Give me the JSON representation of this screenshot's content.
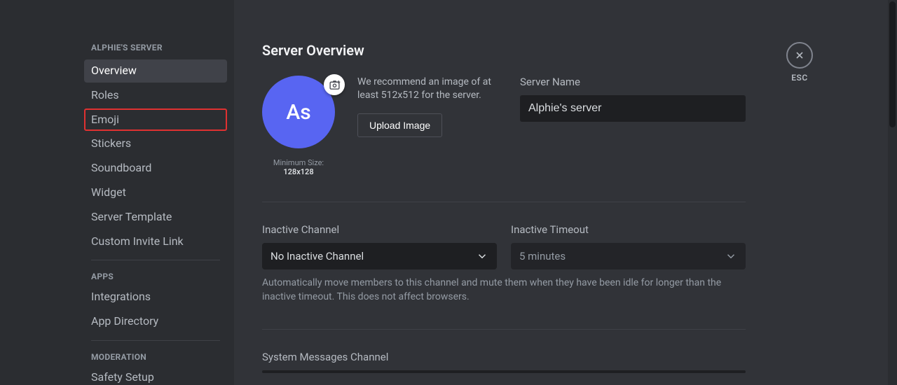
{
  "sidebar": {
    "server_label": "ALPHIE'S SERVER",
    "items": {
      "overview": "Overview",
      "roles": "Roles",
      "emoji": "Emoji",
      "stickers": "Stickers",
      "soundboard": "Soundboard",
      "widget": "Widget",
      "server_template": "Server Template",
      "custom_invite": "Custom Invite Link"
    },
    "apps_label": "APPS",
    "apps": {
      "integrations": "Integrations",
      "app_directory": "App Directory"
    },
    "moderation_label": "MODERATION",
    "moderation": {
      "safety_setup": "Safety Setup"
    }
  },
  "main": {
    "title": "Server Overview",
    "avatar_initials": "As",
    "min_size_label": "Minimum Size: ",
    "min_size_value": "128x128",
    "recommend_text": "We recommend an image of at least 512x512 for the server.",
    "upload_button": "Upload Image",
    "server_name_label": "Server Name",
    "server_name_value": "Alphie's server",
    "inactive_channel_label": "Inactive Channel",
    "inactive_channel_value": "No Inactive Channel",
    "inactive_timeout_label": "Inactive Timeout",
    "inactive_timeout_value": "5 minutes",
    "inactive_help": "Automatically move members to this channel and mute them when they have been idle for longer than the inactive timeout. This does not affect browsers.",
    "system_messages_label": "System Messages Channel"
  },
  "close": {
    "esc": "ESC"
  }
}
